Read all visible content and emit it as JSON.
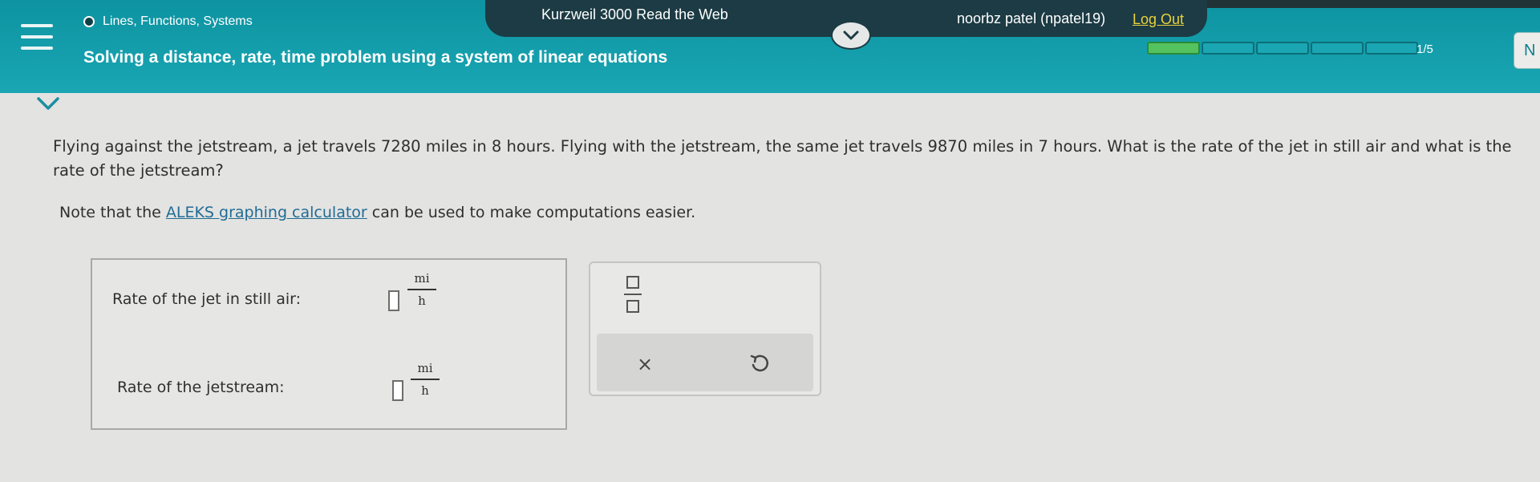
{
  "header": {
    "topic": "Lines, Functions, Systems",
    "lesson_title": "Solving a distance, rate, time problem using a system of linear equations",
    "reader": "Kurzweil 3000 Read the Web",
    "user": "noorbz patel (npatel19)",
    "logout": "Log Out",
    "progress": {
      "count_label": "1/5",
      "filled": 1,
      "total": 5
    },
    "next_label": "N"
  },
  "problem": {
    "text": "Flying against the jetstream, a jet travels 7280 miles in 8 hours. Flying with the jetstream, the same jet travels 9870 miles in 7 hours. What is the rate of the jet in still air and what is the rate of the jetstream?",
    "note_prefix": "Note that the ",
    "note_link": "ALEKS graphing calculator",
    "note_suffix": " can be used to make computations easier."
  },
  "answers": [
    {
      "label": "Rate of the jet in still air:",
      "value": "",
      "unit_num": "mi",
      "unit_den": "h"
    },
    {
      "label": "Rate of the jetstream:",
      "value": "",
      "unit_num": "mi",
      "unit_den": "h"
    }
  ],
  "tools": {
    "clear_symbol": "×"
  },
  "colors": {
    "header": "#1aa6b3",
    "logout": "#e9d13c",
    "link": "#1f6b95",
    "progress_filled": "#54c25f"
  }
}
